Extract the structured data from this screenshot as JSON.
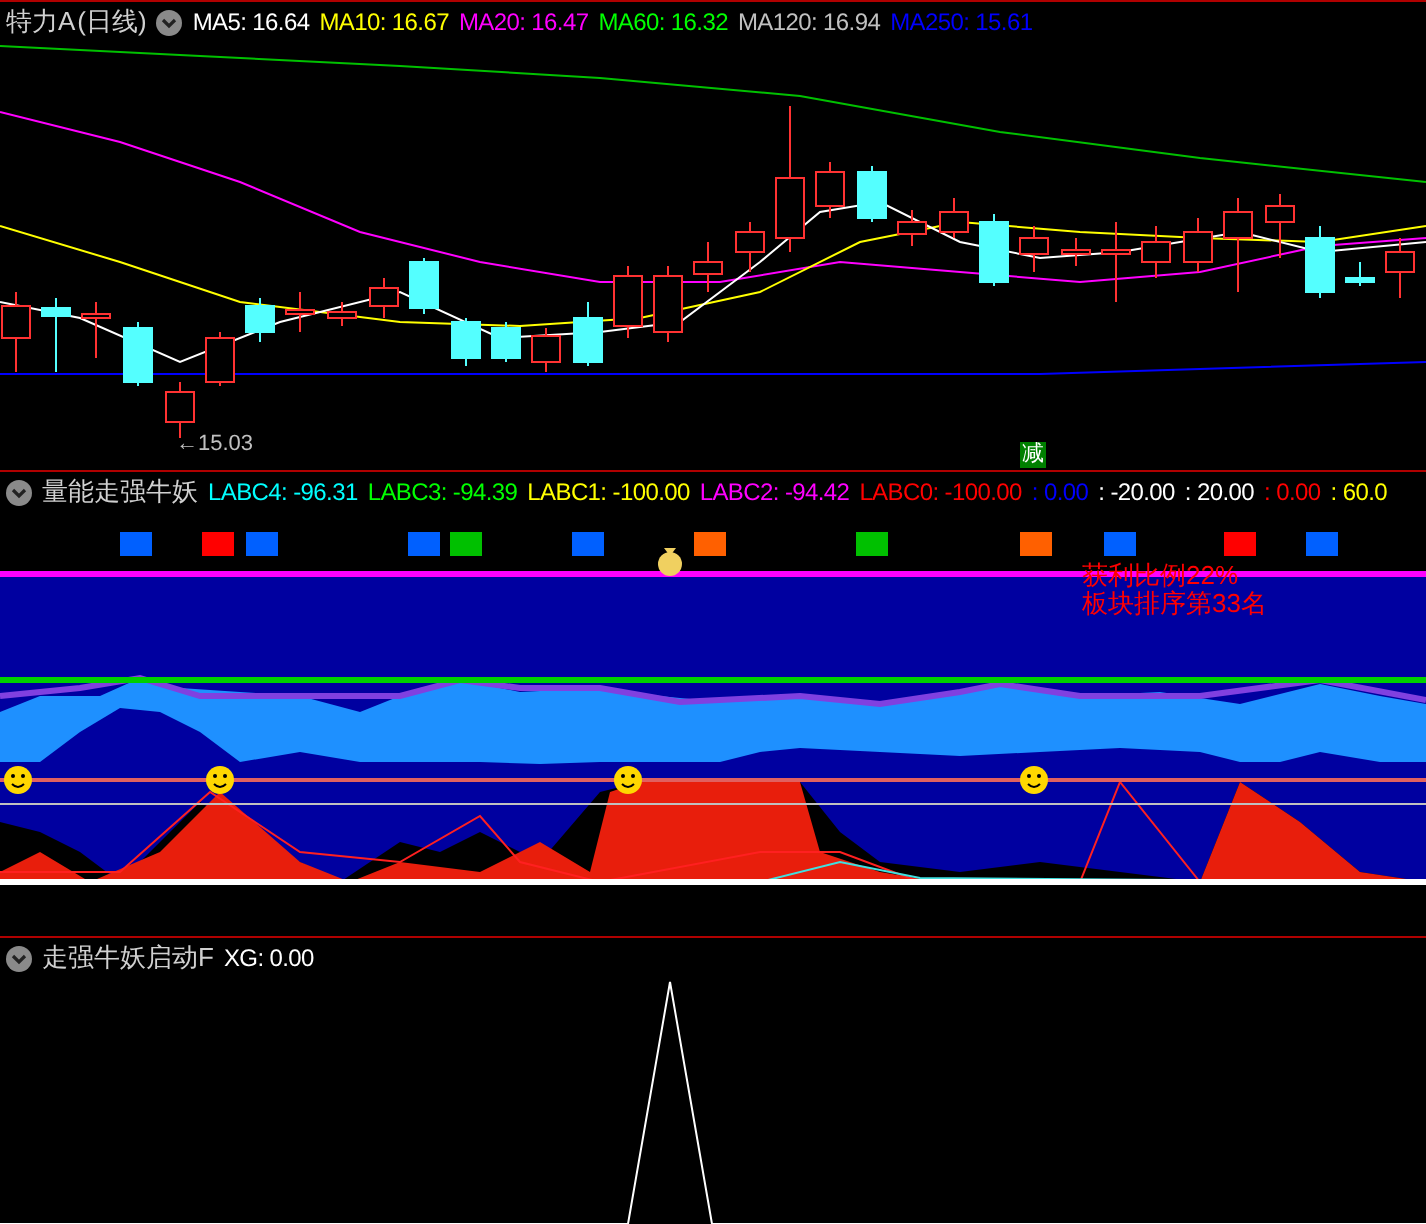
{
  "main_panel": {
    "title": "特力A",
    "period": "(日线)",
    "indicators": [
      {
        "label": "MA5: 16.64",
        "color": "#ffffff"
      },
      {
        "label": "MA10: 16.67",
        "color": "#ffff00"
      },
      {
        "label": "MA20: 16.47",
        "color": "#ff00ff"
      },
      {
        "label": "MA60: 16.32",
        "color": "#00ff00"
      },
      {
        "label": "MA120: 16.94",
        "color": "#c0c0c0"
      },
      {
        "label": "MA250: 15.61",
        "color": "#0000ff"
      }
    ],
    "low_label": "←15.03",
    "signal": "减"
  },
  "volume_panel": {
    "title": "量能走强牛妖",
    "indicators": [
      {
        "label": "LABC4: -96.31",
        "color": "#00ffff"
      },
      {
        "label": "LABC3: -94.39",
        "color": "#00ff00"
      },
      {
        "label": "LABC1: -100.00",
        "color": "#ffff00"
      },
      {
        "label": "LABC2: -94.42",
        "color": "#ff00ff"
      },
      {
        "label": "LABC0: -100.00",
        "color": "#ff0000"
      },
      {
        "label": ": 0.00",
        "color": "#0000ff"
      },
      {
        "label": ": -20.00",
        "color": "#ffffff"
      },
      {
        "label": ": 20.00",
        "color": "#ffffff"
      },
      {
        "label": ": 0.00",
        "color": "#ff0000"
      },
      {
        "label": ": 60.0",
        "color": "#ffff00"
      }
    ],
    "notes": [
      "获利比例22%",
      "板块排序第33名"
    ]
  },
  "start_panel": {
    "title": "走强牛妖启动F",
    "indicators": [
      {
        "label": "XG: 0.00",
        "color": "#ffffff"
      }
    ]
  }
}
